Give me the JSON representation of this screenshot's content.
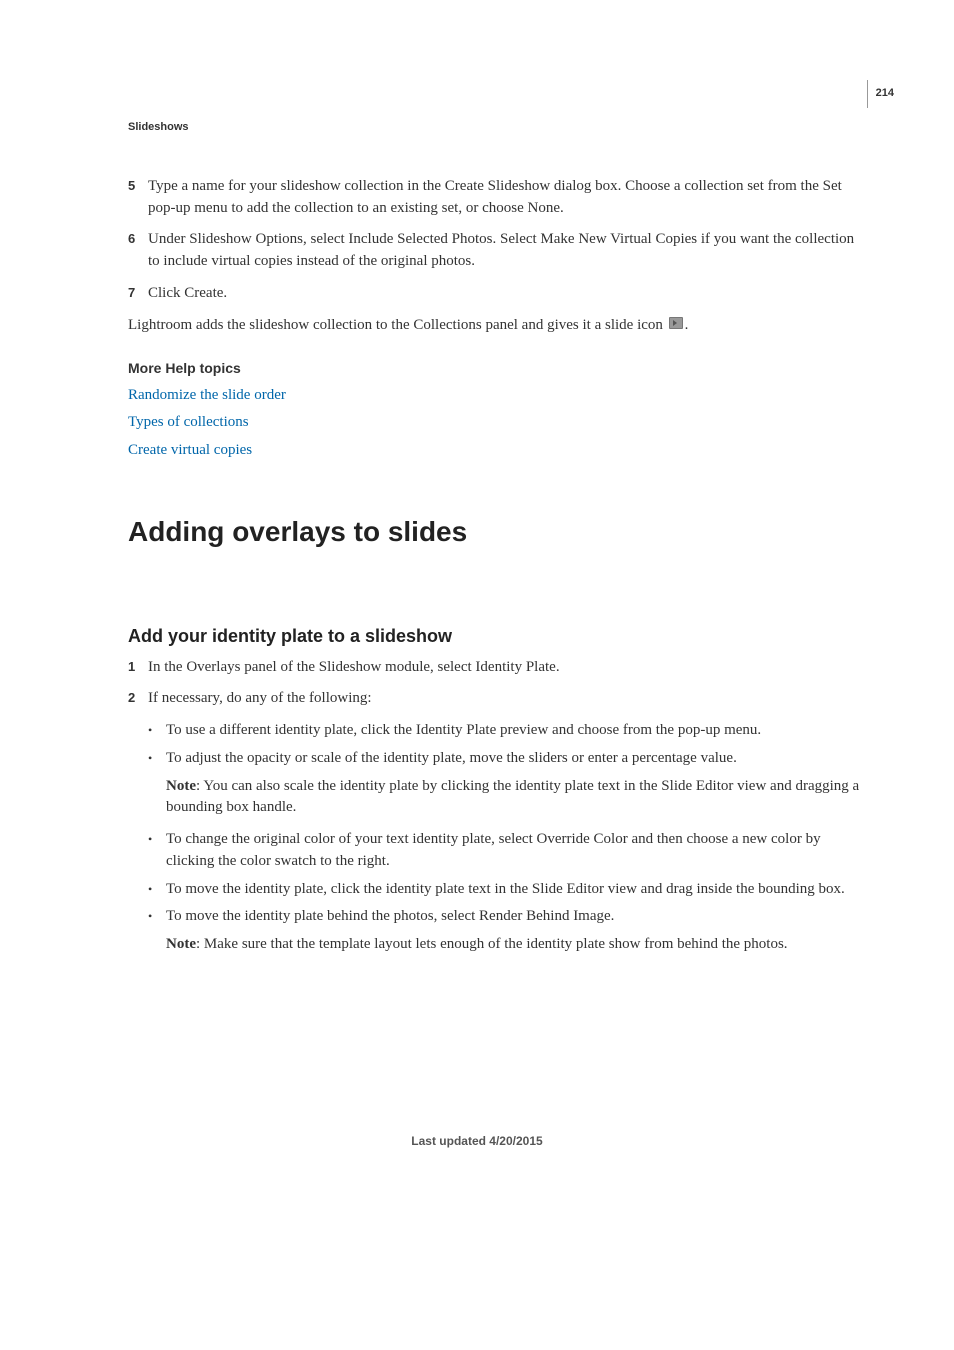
{
  "pageNumber": "214",
  "sectionHeader": "Slideshows",
  "steps": {
    "s5": {
      "num": "5",
      "text": "Type a name for your slideshow collection in the Create Slideshow dialog box. Choose a collection set from the Set pop-up menu to add the collection to an existing set, or choose None."
    },
    "s6": {
      "num": "6",
      "text": "Under Slideshow Options, select Include Selected Photos. Select Make New Virtual Copies if you want the collection to include virtual copies instead of the original photos."
    },
    "s7": {
      "num": "7",
      "text": "Click Create."
    }
  },
  "afterSteps": {
    "pre": "Lightroom adds the slideshow collection to the Collections panel and gives it a slide icon ",
    "post": "."
  },
  "moreHelp": {
    "heading": "More Help topics",
    "links": {
      "l1": "Randomize the slide order",
      "l2": "Types of collections",
      "l3": "Create virtual copies"
    }
  },
  "topicHeading": "Adding overlays to slides",
  "subtopicHeading": "Add your identity plate to a slideshow",
  "sub": {
    "n1": {
      "num": "1",
      "text": "In the Overlays panel of the Slideshow module, select Identity Plate."
    },
    "n2": {
      "num": "2",
      "text": "If necessary, do any of the following:"
    }
  },
  "bullets": {
    "b1": "To use a different identity plate, click the Identity Plate preview and choose from the pop-up menu.",
    "b2": "To adjust the opacity or scale of the identity plate, move the sliders or enter a percentage value.",
    "note1_label": "Note",
    "note1_text": ": You can also scale the identity plate by clicking the identity plate text in the Slide Editor view and dragging a bounding box handle.",
    "b3": "To change the original color of your text identity plate, select Override Color and then choose a new color by clicking the color swatch to the right.",
    "b4": "To move the identity plate, click the identity plate text in the Slide Editor view and drag inside the bounding box.",
    "b5": "To move the identity plate behind the photos, select Render Behind Image.",
    "note2_label": "Note",
    "note2_text": ": Make sure that the template layout lets enough of the identity plate show from behind the photos."
  },
  "footer": "Last updated 4/20/2015"
}
